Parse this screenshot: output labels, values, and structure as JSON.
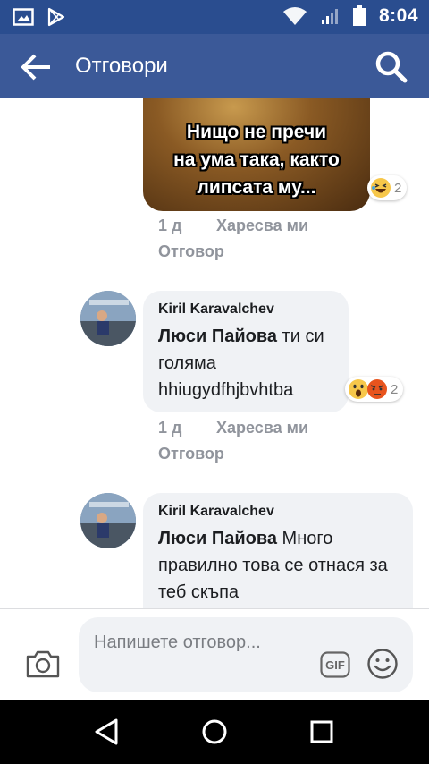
{
  "status_bar": {
    "time": "8:04",
    "icons": [
      "gallery-icon",
      "play-store-icon",
      "wifi-icon",
      "signal-icon",
      "battery-icon"
    ]
  },
  "app_bar": {
    "title": "Отговори",
    "back_icon": "arrow-left-icon",
    "search_icon": "search-icon"
  },
  "colors": {
    "status_bar": "#2a4d8f",
    "app_bar": "#3b5998",
    "bubble_bg": "#f0f2f5",
    "meta_text": "#90949c"
  },
  "thread": {
    "image_comment": {
      "image_text": [
        "Нищо не пречи",
        "на ума така, както",
        "липсата му..."
      ],
      "reactions": [
        "laugh-reaction-icon"
      ],
      "reaction_count": "2",
      "time": "1 д",
      "like_label": "Харесва ми",
      "reply_label": "Отговор"
    },
    "comments": [
      {
        "author": "Kiril Karavalchev",
        "mention": "Люси Пайова",
        "text": " ти си голяма hhiugydfhjbvhtba",
        "reactions": [
          "wow-reaction-icon",
          "angry-reaction-icon"
        ],
        "reaction_count": "2",
        "time": "1 д",
        "like_label": "Харесва ми",
        "reply_label": "Отговор"
      },
      {
        "author": "Kiril Karavalchev",
        "mention": "Люси Пайова",
        "text": " Много правилно това се отнася за теб скъпа"
      }
    ]
  },
  "composer": {
    "placeholder": "Напишете отговор...",
    "camera_icon": "camera-icon",
    "gif_label": "GIF",
    "emoji_icon": "smiley-icon"
  },
  "nav_bar": {
    "icons": [
      "back-triangle-icon",
      "home-circle-icon",
      "recents-square-icon"
    ]
  }
}
